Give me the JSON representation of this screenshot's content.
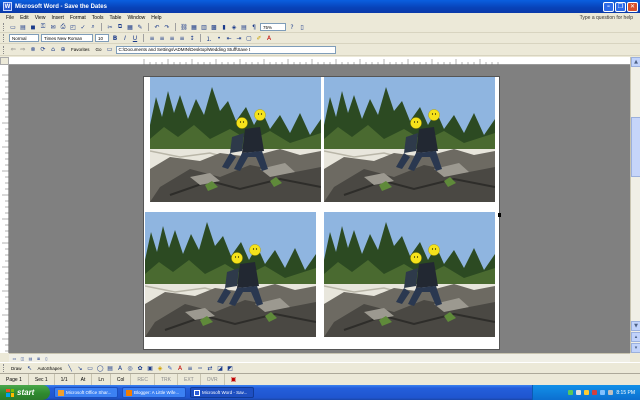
{
  "window": {
    "title": "Microsoft Word - Save the Dates",
    "app_icon": "word-icon"
  },
  "menu": {
    "items": [
      "File",
      "Edit",
      "View",
      "Insert",
      "Format",
      "Tools",
      "Table",
      "Window",
      "Help"
    ],
    "help_text": "Type a question for help"
  },
  "standard_toolbar": {
    "zoom": "75%"
  },
  "formatting_toolbar": {
    "style": "Normal",
    "font": "Times New Roman",
    "size": "10"
  },
  "web_toolbar": {
    "favorites": "Favorites",
    "go": "Go",
    "address": "C:\\Documents and Settings\\ADMIN\\Desktop\\Wedding Stuff\\Save t"
  },
  "drawing_toolbar": {
    "draw": "Draw",
    "autoshapes": "AutoShapes"
  },
  "status": {
    "page": "Page 1",
    "sec": "Sec 1",
    "pages": "1/1",
    "at": "At",
    "ln": "Ln",
    "col": "Col",
    "rec": "REC",
    "trk": "TRK",
    "ext": "EXT",
    "ovr": "OVR"
  },
  "taskbar": {
    "start": "start",
    "tasks": [
      {
        "label": "Microsoft Office Shar...",
        "active": false
      },
      {
        "label": "Blogger: A Little Wife...",
        "active": false
      },
      {
        "label": "Microsoft Word - Sav...",
        "active": true
      }
    ],
    "clock": "8:15 PM"
  },
  "colors": {
    "title_bar": "#0842b8",
    "taskbar": "#245edb",
    "start_button": "#2f8a2f",
    "workspace": "#808080"
  }
}
